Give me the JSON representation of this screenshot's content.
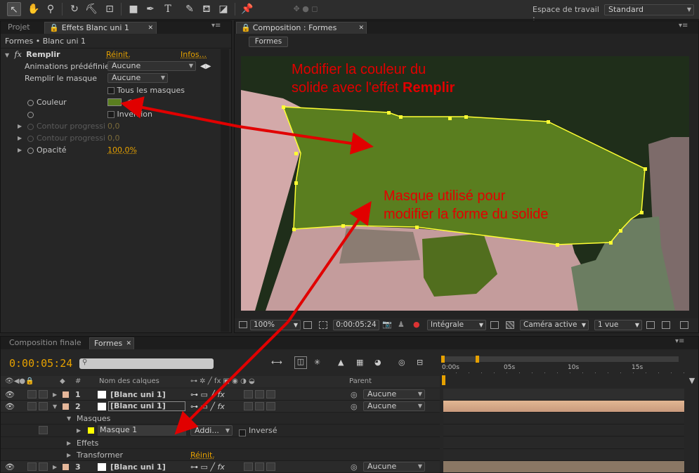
{
  "app": {
    "workspace_label": "Espace de travail :",
    "workspace_value": "Standard"
  },
  "effects_panel": {
    "tabs": [
      "Projet",
      "Effets Blanc uni 1"
    ],
    "breadcrumb": "Formes • Blanc uni 1",
    "effect_name": "Remplir",
    "reset": "Réinit.",
    "info": "Infos...",
    "rows": [
      {
        "label": "Animations prédéfinie",
        "value": "Aucune"
      },
      {
        "label": "Remplir le masque",
        "value": "Aucune"
      },
      {
        "label": "Tous les masques"
      },
      {
        "label": "Couleur",
        "color": "#5a7e1f"
      },
      {
        "label": "Inversion"
      },
      {
        "label": "Contour progressi",
        "value": "0,0"
      },
      {
        "label": "Contour progressi",
        "value": "0,0"
      },
      {
        "label": "Opacité",
        "value": "100,0%"
      }
    ]
  },
  "composition": {
    "tab": "Composition : Formes",
    "subtab": "Formes",
    "annotation1": {
      "line1": "Modifier la couleur du",
      "line2_prefix": "solide avec l'effet ",
      "line2_bold": "Remplir"
    },
    "annotation2": {
      "line1": "Masque utilisé pour",
      "line2": "modifier la forme du solide"
    },
    "bottom_bar": {
      "zoom": "100%",
      "timecode": "0:00:05:24",
      "quality": "Intégrale",
      "camera": "Caméra active",
      "views": "1 vue"
    }
  },
  "timeline": {
    "tabs": [
      "Composition finale",
      "Formes"
    ],
    "current_time": "0:00:05:24",
    "columns": {
      "hash": "#",
      "name": "Nom des calques",
      "parent": "Parent"
    },
    "ruler": [
      "0:00s",
      "05s",
      "10s",
      "15s"
    ],
    "layers": [
      {
        "num": "1",
        "name": "[Blanc uni 1]",
        "parent": "Aucune"
      },
      {
        "num": "2",
        "name": "[Blanc uni 1]",
        "parent": "Aucune"
      },
      {
        "num": "3",
        "name": "[Blanc uni 1]",
        "parent": "Aucune"
      }
    ],
    "masks_group": "Masques",
    "mask": {
      "name": "Masque 1",
      "mode": "Addi...",
      "inverted": "Inversé"
    },
    "effects_group": "Effets",
    "transform_group": "Transformer",
    "transform_reset": "Réinit."
  },
  "colors": {
    "accent_orange": "#e6a100",
    "annotation_red": "#e10000",
    "fill_green": "#5a7e1f",
    "mask_yellow": "#ffff00"
  }
}
